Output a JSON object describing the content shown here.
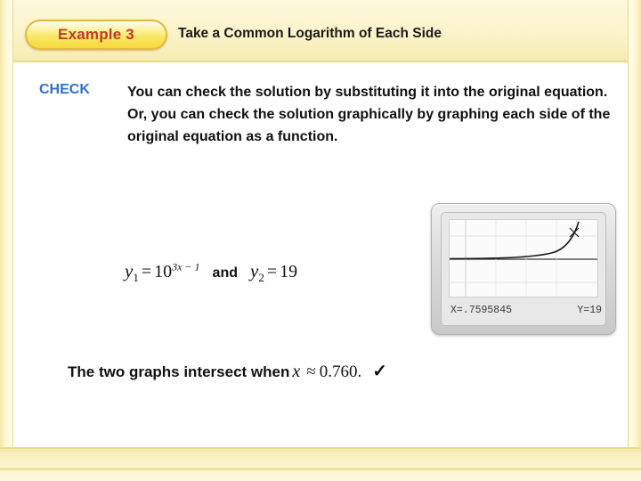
{
  "header": {
    "example_label": "Example 3",
    "title": "Take a Common Logarithm of Each Side"
  },
  "body": {
    "check_label": "CHECK",
    "check_text": "You can check the solution by substituting it into the original equation. Or, you can check the solution graphically by graphing each side of the original equation as a function."
  },
  "equation": {
    "y1_var": "y",
    "y1_sub": "1",
    "equals": "=",
    "base": "10",
    "exponent": "3x − 1",
    "and": "and",
    "y2_var": "y",
    "y2_sub": "2",
    "equals2": "=",
    "y2_value": "19"
  },
  "calculator": {
    "x_readout": "X=.7595845",
    "y_readout": "Y=19"
  },
  "conclusion": {
    "text_before": "The two graphs intersect when",
    "variable": "x",
    "approx_symbol": "≈",
    "value": "0.760.",
    "checkmark": "✓"
  },
  "colors": {
    "example_label": "#c0392b",
    "check_label": "#2f6fd0",
    "band": "#fbf3c8",
    "text": "#111111"
  }
}
